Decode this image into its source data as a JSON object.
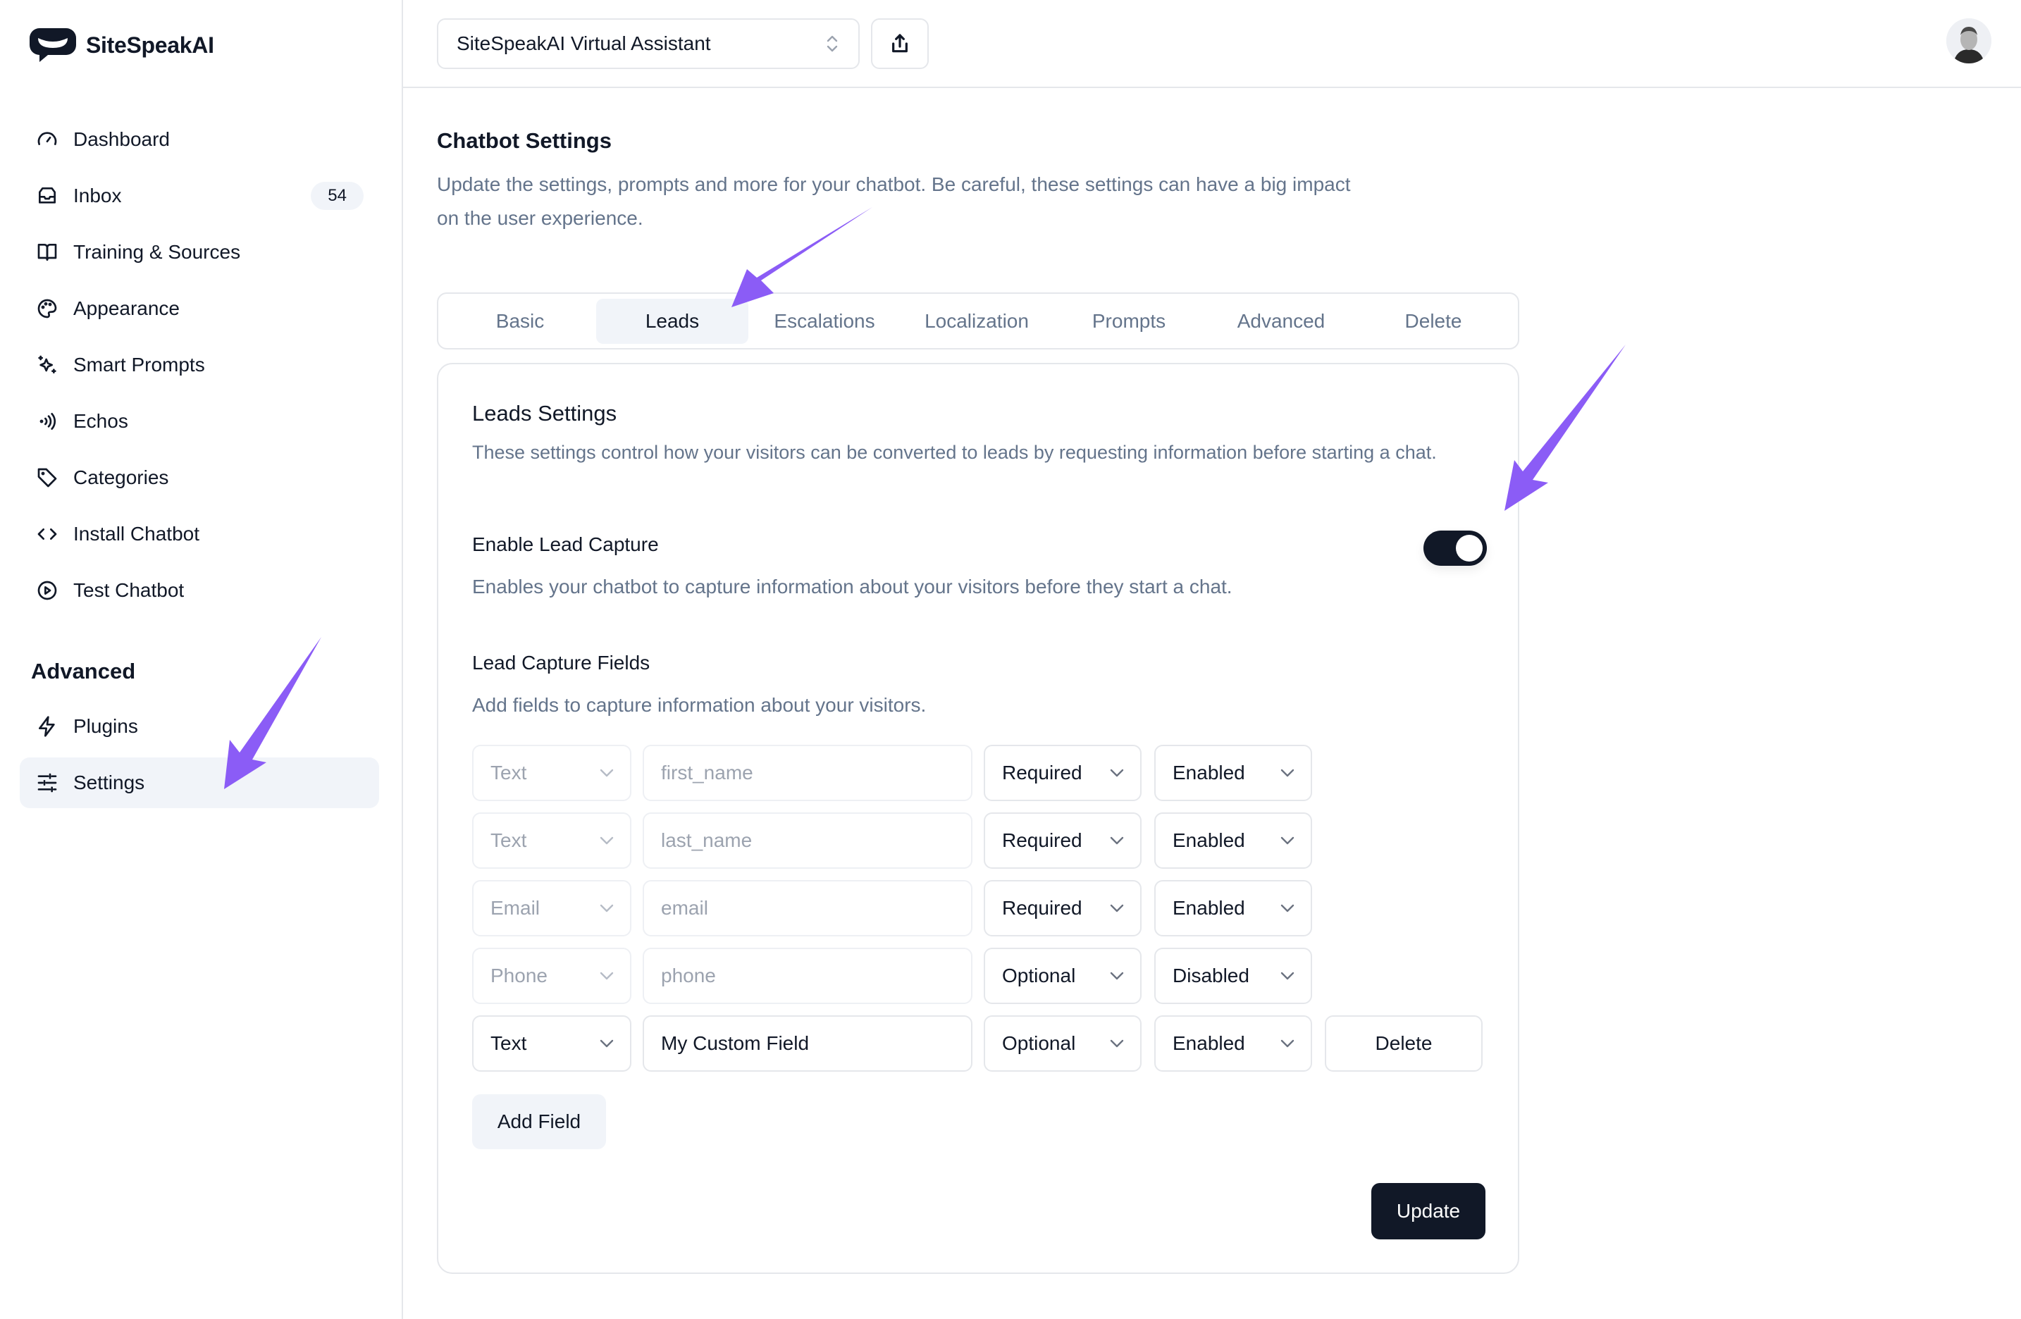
{
  "app": {
    "name": "SiteSpeakAI",
    "accent_color": "#8b5cf6",
    "primary_color": "#111827"
  },
  "sidebar": {
    "items": [
      {
        "label": "Dashboard",
        "icon": "gauge-icon"
      },
      {
        "label": "Inbox",
        "icon": "inbox-icon",
        "badge": "54"
      },
      {
        "label": "Training & Sources",
        "icon": "book-open-icon"
      },
      {
        "label": "Appearance",
        "icon": "palette-icon"
      },
      {
        "label": "Smart Prompts",
        "icon": "sparkles-icon"
      },
      {
        "label": "Echos",
        "icon": "signal-icon"
      },
      {
        "label": "Categories",
        "icon": "tag-icon"
      },
      {
        "label": "Install Chatbot",
        "icon": "code-icon"
      },
      {
        "label": "Test Chatbot",
        "icon": "play-circle-icon"
      }
    ],
    "section_title": "Advanced",
    "advanced_items": [
      {
        "label": "Plugins",
        "icon": "zap-icon"
      },
      {
        "label": "Settings",
        "icon": "sliders-icon",
        "active": true
      }
    ]
  },
  "topbar": {
    "chatbot_select": "SiteSpeakAI Virtual Assistant",
    "share_icon": "share-icon",
    "avatar_alt": "user avatar"
  },
  "page": {
    "title": "Chatbot Settings",
    "description": "Update the settings, prompts and more for your chatbot. Be careful, these settings can have a big impact on the user experience."
  },
  "tabs": [
    {
      "label": "Basic"
    },
    {
      "label": "Leads",
      "active": true
    },
    {
      "label": "Escalations"
    },
    {
      "label": "Localization"
    },
    {
      "label": "Prompts"
    },
    {
      "label": "Advanced"
    },
    {
      "label": "Delete"
    }
  ],
  "leads": {
    "title": "Leads Settings",
    "description": "These settings control how your visitors can be converted to leads by requesting information before starting a chat.",
    "enable_label": "Enable Lead Capture",
    "enable_on": true,
    "enable_description": "Enables your chatbot to capture information about your visitors before they start a chat.",
    "fields_title": "Lead Capture Fields",
    "fields_description": "Add fields to capture information about your visitors.",
    "fields": [
      {
        "type": "Text",
        "name": "first_name",
        "required": "Required",
        "status": "Enabled",
        "locked": true
      },
      {
        "type": "Text",
        "name": "last_name",
        "required": "Required",
        "status": "Enabled",
        "locked": true
      },
      {
        "type": "Email",
        "name": "email",
        "required": "Required",
        "status": "Enabled",
        "locked": true
      },
      {
        "type": "Phone",
        "name": "phone",
        "required": "Optional",
        "status": "Disabled",
        "locked": true
      },
      {
        "type": "Text",
        "name": "My Custom Field",
        "required": "Optional",
        "status": "Enabled",
        "locked": false,
        "delete_label": "Delete"
      }
    ],
    "add_field_label": "Add Field",
    "update_label": "Update"
  }
}
